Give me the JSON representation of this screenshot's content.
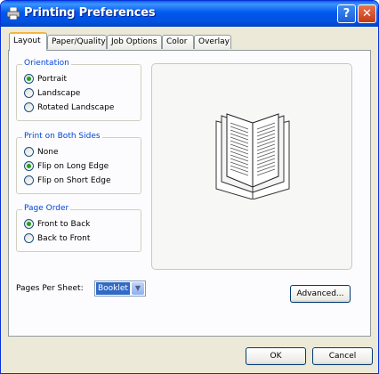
{
  "window": {
    "title": "Printing Preferences",
    "help_label": "?",
    "close_label": "✕"
  },
  "tabs": [
    {
      "label": "Layout"
    },
    {
      "label": "Paper/Quality"
    },
    {
      "label": "Job Options"
    },
    {
      "label": "Color"
    },
    {
      "label": "Overlay"
    }
  ],
  "orientation": {
    "legend": "Orientation",
    "options": [
      {
        "label": "Portrait",
        "checked": true
      },
      {
        "label": "Landscape",
        "checked": false
      },
      {
        "label": "Rotated Landscape",
        "checked": false
      }
    ]
  },
  "both_sides": {
    "legend": "Print on Both Sides",
    "options": [
      {
        "label": "None",
        "checked": false
      },
      {
        "label": "Flip on Long Edge",
        "checked": true
      },
      {
        "label": "Flip on Short Edge",
        "checked": false
      }
    ]
  },
  "page_order": {
    "legend": "Page Order",
    "options": [
      {
        "label": "Front to Back",
        "checked": true
      },
      {
        "label": "Back to Front",
        "checked": false
      }
    ]
  },
  "pages_per_sheet": {
    "label": "Pages Per Sheet:",
    "value": "Booklet"
  },
  "buttons": {
    "advanced": "Advanced...",
    "ok": "OK",
    "cancel": "Cancel"
  },
  "icons": {
    "title": "printer-icon",
    "preview": "open-book-icon"
  }
}
